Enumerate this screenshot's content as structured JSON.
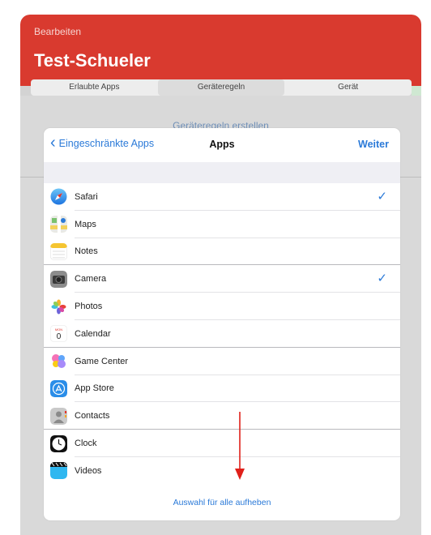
{
  "header": {
    "edit_label": "Bearbeiten",
    "title": "Test-Schueler",
    "color": "#d93a2f"
  },
  "segments": [
    {
      "label": "Erlaubte Apps"
    },
    {
      "label": "Geräteregeln",
      "active": true
    },
    {
      "label": "Gerät"
    }
  ],
  "background": {
    "link_text": "Geräteregeln erstellen"
  },
  "sheet": {
    "back_label": "Eingeschränkte Apps",
    "title": "Apps",
    "next_label": "Weiter",
    "footer_link": "Auswahl für alle aufheben",
    "accent_color": "#2b7ad8"
  },
  "apps": [
    {
      "name": "Safari",
      "icon": "safari-icon",
      "checked": true
    },
    {
      "name": "Maps",
      "icon": "maps-icon",
      "checked": false
    },
    {
      "name": "Notes",
      "icon": "notes-icon",
      "checked": false
    },
    {
      "name": "Camera",
      "icon": "camera-icon",
      "checked": true
    },
    {
      "name": "Photos",
      "icon": "photos-icon",
      "checked": false
    },
    {
      "name": "Calendar",
      "icon": "calendar-icon",
      "checked": false
    },
    {
      "name": "Game Center",
      "icon": "game-center-icon",
      "checked": false
    },
    {
      "name": "App Store",
      "icon": "app-store-icon",
      "checked": false
    },
    {
      "name": "Contacts",
      "icon": "contacts-icon",
      "checked": false
    },
    {
      "name": "Clock",
      "icon": "clock-icon",
      "checked": false
    },
    {
      "name": "Videos",
      "icon": "videos-icon",
      "checked": false
    }
  ],
  "annotation": {
    "arrow_color": "#e0201a",
    "icon": "red-down-arrow-icon"
  }
}
